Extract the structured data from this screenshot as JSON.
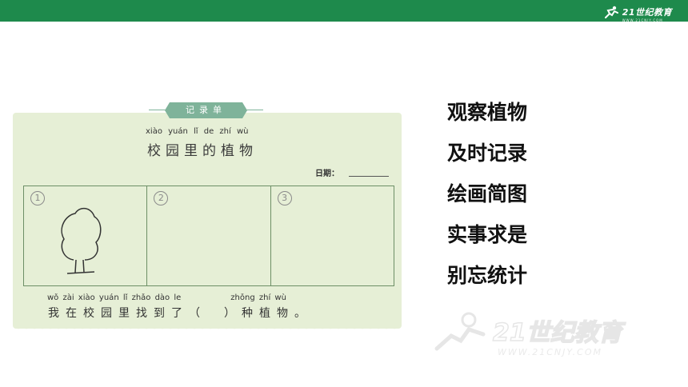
{
  "header": {
    "logo_text": "21世纪教育",
    "logo_sub": "WWW.21CNJY.COM",
    "bar_color": "#1e8a4c"
  },
  "record_card": {
    "tag_label": "记录单",
    "title_pinyin": "xiào yuán lǐ de zhí wù",
    "title": "校园里的植物",
    "date_label": "日期：",
    "cells": [
      {
        "number": "1",
        "icon": "tree-drawing"
      },
      {
        "number": "2"
      },
      {
        "number": "3"
      }
    ],
    "bottom_pinyin_left": "wǒ zài xiào yuán lǐ zhǎo dào le",
    "bottom_pinyin_right": "zhǒng zhí wù",
    "bottom_text": "我在校园里找到了（　）种植物。",
    "card_color": "#e6efd6"
  },
  "steps": [
    "观察植物",
    "及时记录",
    "绘画简图",
    "实事求是",
    "别忘统计"
  ],
  "watermark": {
    "text": "21世纪教育",
    "sub": "WWW.21CNJY.COM"
  }
}
